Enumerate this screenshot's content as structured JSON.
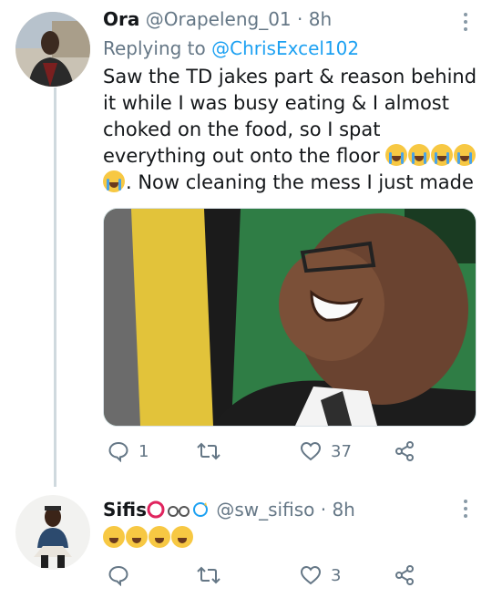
{
  "tweet1": {
    "name": "Ora",
    "handle": "@Orapeleng_01",
    "sep": "·",
    "time": "8h",
    "replying_prefix": "Replying to",
    "replying_handle": "@ChrisExcel102",
    "text_part1": "Saw the TD jakes part & reason behind it while I was busy eating & I almost choked on the food, so I spat everything out onto the floor",
    "text_part2": ". Now cleaning the mess I just made",
    "emoji_inline": [
      "loudly-crying-face",
      "loudly-crying-face",
      "loudly-crying-face",
      "loudly-crying-face",
      "loudly-crying-face"
    ],
    "actions": {
      "replies": "1",
      "retweets": "",
      "likes": "37"
    }
  },
  "tweet2": {
    "name": "Sifis",
    "name_emoji": [
      "red-circle",
      "glasses",
      "dizzy-symbol"
    ],
    "handle": "@sw_sifiso",
    "sep": "·",
    "time": "8h",
    "emoji_text": [
      "face-with-tears-of-joy",
      "face-with-tears-of-joy",
      "face-with-tears-of-joy",
      "face-with-tears-of-joy"
    ],
    "actions": {
      "replies": "",
      "retweets": "",
      "likes": "3"
    }
  },
  "colors": {
    "link": "#1da1f2",
    "muted": "#657786",
    "line": "#cfd9de"
  }
}
